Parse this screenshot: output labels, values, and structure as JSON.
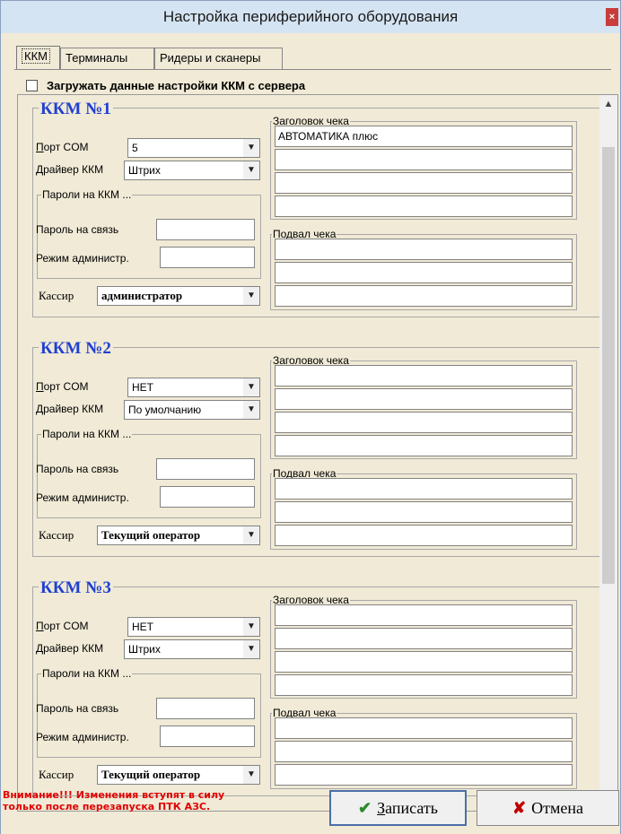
{
  "window": {
    "title": "Настройка периферийного оборудования",
    "close_glyph": "×"
  },
  "tabs": [
    {
      "label": "ККМ",
      "active": true
    },
    {
      "label": "Терминалы",
      "active": false
    },
    {
      "label": "Ридеры и сканеры",
      "active": false
    }
  ],
  "load_from_server": {
    "label": "Загружать данные настройки ККМ с сервера",
    "checked": false
  },
  "labels": {
    "port": "Порт COM",
    "port_first": "П",
    "port_rest": "орт COM",
    "driver": "Драйвер ККМ",
    "passwords_group": "Пароли на ККМ ...",
    "password_link": "Пароль на связь",
    "password_admin": "Режим администр.",
    "cashier": "Кассир",
    "header_group": "Заголовок чека",
    "footer_group": "Подвал чека"
  },
  "kkm": [
    {
      "title": "ККМ №1",
      "port": "5",
      "driver": "Штрих",
      "password_link": "",
      "password_admin": "",
      "cashier": "администратор",
      "header_lines": [
        "АВТОМАТИКА плюс",
        "",
        "",
        ""
      ],
      "footer_lines": [
        "",
        "",
        ""
      ]
    },
    {
      "title": "ККМ №2",
      "port": "НЕТ",
      "driver": "По умолчанию",
      "password_link": "",
      "password_admin": "",
      "cashier": "Текущий оператор",
      "header_lines": [
        "",
        "",
        "",
        ""
      ],
      "footer_lines": [
        "",
        "",
        ""
      ]
    },
    {
      "title": "ККМ №3",
      "port": "НЕТ",
      "driver": "Штрих",
      "password_link": "",
      "password_admin": "",
      "cashier": "Текущий оператор",
      "header_lines": [
        "",
        "",
        "",
        ""
      ],
      "footer_lines": [
        "",
        "",
        ""
      ]
    }
  ],
  "warning": {
    "line1": "Внимание!!! Изменения вступят в силу",
    "line2": "только после перезапуска ПТК АЗС."
  },
  "buttons": {
    "save_underlined": "З",
    "save_rest": "аписать",
    "cancel": "Отмена"
  },
  "icons": {
    "save": "checkmark-icon",
    "cancel": "cross-icon",
    "dropdown": "chevron-down-icon"
  },
  "colors": {
    "kkm_title": "#2040d0",
    "warning": "#e00000",
    "save_icon": "#2a8a2a",
    "cancel_icon": "#c00000"
  }
}
